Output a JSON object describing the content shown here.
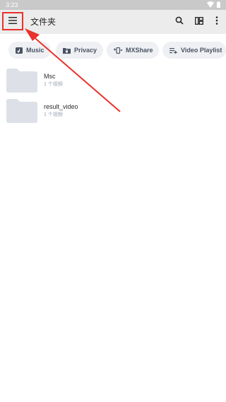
{
  "status_bar": {
    "time": "3:23",
    "wifi_icon": "wifi-icon",
    "battery_icon": "battery-icon"
  },
  "app_bar": {
    "menu_icon": "hamburger-menu-icon",
    "title": "文件夹",
    "actions": [
      "search-icon",
      "view-layout-icon",
      "more-vert-icon"
    ]
  },
  "chips": [
    {
      "label": "Music",
      "icon": "music-icon"
    },
    {
      "label": "Privacy",
      "icon": "lock-folder-icon"
    },
    {
      "label": "MXShare",
      "icon": "mxshare-icon"
    },
    {
      "label": "Video Playlist",
      "icon": "playlist-add-icon"
    }
  ],
  "folders": [
    {
      "name": "Msc",
      "count": "1 个视频"
    },
    {
      "name": "result_video",
      "count": "1 个视频"
    }
  ],
  "colors": {
    "highlight": "#e8312a",
    "app_bar_bg": "#ececec",
    "chip_bg": "#eef0f3",
    "folder_thumb": "#dde1e7"
  }
}
